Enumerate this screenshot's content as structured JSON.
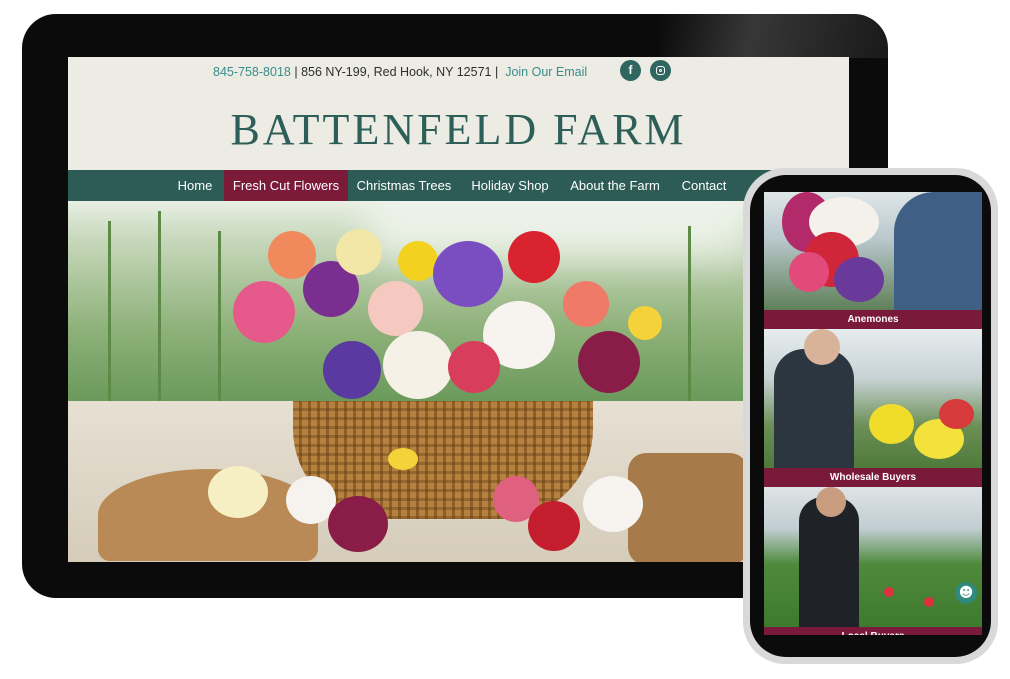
{
  "topbar": {
    "phone": "845-758-8018",
    "separator": "|",
    "address": "856 NY-199, Red Hook, NY 12571",
    "join": "Join Our Email",
    "social": [
      {
        "icon": "facebook-icon",
        "glyph": "f"
      },
      {
        "icon": "instagram-icon"
      }
    ]
  },
  "brand": {
    "title": "BATTENFELD FARM"
  },
  "nav": {
    "items": [
      {
        "label": "Home",
        "active": false
      },
      {
        "label": "Fresh Cut Flowers",
        "active": true
      },
      {
        "label": "Christmas Trees",
        "active": false
      },
      {
        "label": "Holiday Shop",
        "active": false
      },
      {
        "label": "About the Farm",
        "active": false
      },
      {
        "label": "Contact",
        "active": false
      }
    ]
  },
  "mobile": {
    "panels": [
      {
        "label": "Anemones"
      },
      {
        "label": "Wholesale Buyers"
      },
      {
        "label": "Local Buyers"
      }
    ],
    "accessibility_icon": "accessibility-icon"
  },
  "colors": {
    "teal_dark": "#2c5c55",
    "teal_link": "#3a8d8c",
    "maroon": "#7c1a3a",
    "header_bg": "#ecebe4"
  }
}
